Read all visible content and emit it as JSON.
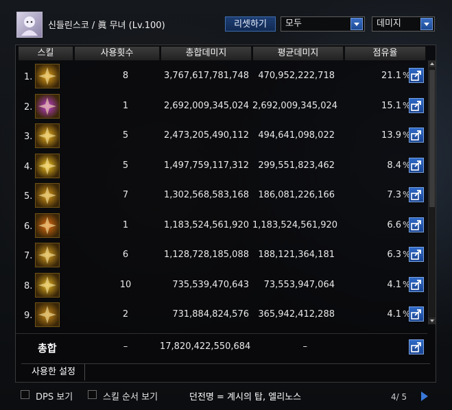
{
  "header": {
    "character_name": "신들린스코 / 眞 무녀 (Lv.100)",
    "reset_label": "리셋하기",
    "filter_dropdown": "모두",
    "metric_dropdown": "데미지"
  },
  "columns": [
    "스킬",
    "사용횟수",
    "총합데미지",
    "평균데미지",
    "점유율"
  ],
  "rows": [
    {
      "rank": "1.",
      "count": "8",
      "total": "3,767,617,781,748",
      "avg": "470,952,222,718",
      "pct": "21.1",
      "icon": "sun-burst-icon",
      "color": "#e0a018"
    },
    {
      "rank": "2.",
      "count": "1",
      "total": "2,692,009,345,024",
      "avg": "2,692,009,345,024",
      "pct": "15.1",
      "icon": "pink-star-icon",
      "color": "#c040d0"
    },
    {
      "rank": "3.",
      "count": "5",
      "total": "2,473,205,490,112",
      "avg": "494,641,098,022",
      "pct": "13.9",
      "icon": "crossed-blades-icon",
      "color": "#e8b020"
    },
    {
      "rank": "4.",
      "count": "5",
      "total": "1,497,759,117,312",
      "avg": "299,551,823,462",
      "pct": "8.4",
      "icon": "radiant-orb-icon",
      "color": "#f0c020"
    },
    {
      "rank": "5.",
      "count": "7",
      "total": "1,302,568,583,168",
      "avg": "186,081,226,166",
      "pct": "7.3",
      "icon": "dragon-icon",
      "color": "#d89a18"
    },
    {
      "rank": "6.",
      "count": "1",
      "total": "1,183,524,561,920",
      "avg": "1,183,524,561,920",
      "pct": "6.6",
      "icon": "fire-wave-icon",
      "color": "#e07010"
    },
    {
      "rank": "7.",
      "count": "6",
      "total": "1,128,728,185,088",
      "avg": "188,121,364,181",
      "pct": "6.3",
      "icon": "beast-icon",
      "color": "#d8a020"
    },
    {
      "rank": "8.",
      "count": "10",
      "total": "735,539,470,643",
      "avg": "73,553,947,064",
      "pct": "4.1",
      "icon": "spiral-icon",
      "color": "#e0b020"
    },
    {
      "rank": "9.",
      "count": "2",
      "total": "731,884,824,576",
      "avg": "365,942,412,288",
      "pct": "4.1",
      "icon": "bird-icon",
      "color": "#c88a18"
    }
  ],
  "percent_symbol": "%",
  "total": {
    "label": "총합",
    "count": "–",
    "total": "17,820,422,550,684",
    "avg": "–"
  },
  "tabs": {
    "used_settings": "사용한 설정"
  },
  "footer": {
    "dps_label": "DPS 보기",
    "skill_order_label": "스킬 순서 보기",
    "dungeon": "던전명 = 계시의 탑, 엘리노스",
    "page": "4/ 5"
  }
}
